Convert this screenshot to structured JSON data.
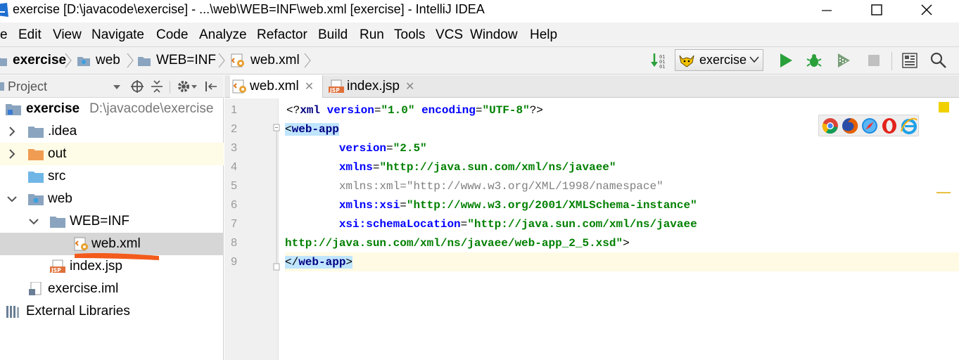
{
  "window": {
    "title": "exercise [D:\\javacode\\exercise] - ...\\web\\WEB=INF\\web.xml [exercise] - IntelliJ IDEA",
    "minimize_icon": "minimize-icon",
    "maximize_icon": "maximize-icon",
    "close_icon": "close-icon"
  },
  "menu": {
    "items": [
      "e",
      "Edit",
      "View",
      "Navigate",
      "Code",
      "Analyze",
      "Refactor",
      "Build",
      "Run",
      "Tools",
      "VCS",
      "Window",
      "Help"
    ]
  },
  "breadcrumb": {
    "items": [
      "exercise",
      "web",
      "WEB=INF",
      "web.xml"
    ]
  },
  "toolbar": {
    "run_config": "exercise",
    "icons": [
      "sort-binary-icon",
      "tomcat-icon",
      "run-icon",
      "debug-icon",
      "coverage-icon",
      "stop-icon",
      "project-structure-icon",
      "search-icon"
    ],
    "colors": {
      "run": "#2aa03a",
      "debug": "#2aa03a",
      "stop": "#c0c0c0"
    }
  },
  "project_panel": {
    "title": "Project",
    "tree": [
      {
        "label": "exercise",
        "path": "D:\\javacode\\exercise",
        "icon": "module-folder-icon"
      },
      {
        "label": ".idea",
        "icon": "folder-icon"
      },
      {
        "label": "out",
        "icon": "excluded-folder-icon"
      },
      {
        "label": "src",
        "icon": "source-folder-icon"
      },
      {
        "label": "web",
        "icon": "web-folder-icon"
      },
      {
        "label": "WEB=INF",
        "icon": "folder-icon"
      },
      {
        "label": "web.xml",
        "icon": "xml-file-icon"
      },
      {
        "label": "index.jsp",
        "icon": "jsp-file-icon"
      },
      {
        "label": "exercise.iml",
        "icon": "iml-file-icon"
      },
      {
        "label": "External Libraries",
        "icon": "libraries-icon"
      }
    ]
  },
  "tabs": [
    {
      "label": "web.xml",
      "icon": "xml-file-icon",
      "active": true
    },
    {
      "label": "index.jsp",
      "icon": "jsp-file-icon",
      "active": false
    }
  ],
  "editor": {
    "line_numbers": [
      "1",
      "2",
      "3",
      "4",
      "5",
      "6",
      "7",
      "8",
      "9"
    ],
    "lines": {
      "l1": {
        "a": "<?",
        "b": "xml ",
        "c": "version",
        "d": "=",
        "e": "\"1.0\"",
        "f": " ",
        "g": "encoding",
        "h": "=",
        "i": "\"UTF-8\"",
        "j": "?>"
      },
      "l2": {
        "a": "<",
        "b": "web-app"
      },
      "l3": {
        "indent": "        ",
        "attr": "version",
        "eq": "=",
        "val": "\"2.5\""
      },
      "l4": {
        "indent": "        ",
        "attr": "xmlns",
        "eq": "=",
        "val": "\"http://java.sun.com/xml/ns/javaee\""
      },
      "l5": {
        "indent": "        ",
        "attr": "xmlns:xml",
        "eq": "=",
        "val": "\"http://www.w3.org/XML/1998/namespace\""
      },
      "l6": {
        "indent": "        ",
        "attr": "xmlns:xsi",
        "eq": "=",
        "val": "\"http://www.w3.org/2001/XMLSchema-instance\""
      },
      "l7": {
        "indent": "        ",
        "attr": "xsi:schemaLocation",
        "eq": "=",
        "val": "\"http://java.sun.com/xml/ns/javaee"
      },
      "l8": {
        "val": "http://java.sun.com/xml/ns/javaee/web-app_2_5.xsd\"",
        "close": ">"
      },
      "l9": {
        "a": "</",
        "b": "web-app",
        "c": ">"
      }
    },
    "browser_icons": [
      "chrome-icon",
      "firefox-icon",
      "safari-icon",
      "opera-icon",
      "ie-icon"
    ]
  }
}
